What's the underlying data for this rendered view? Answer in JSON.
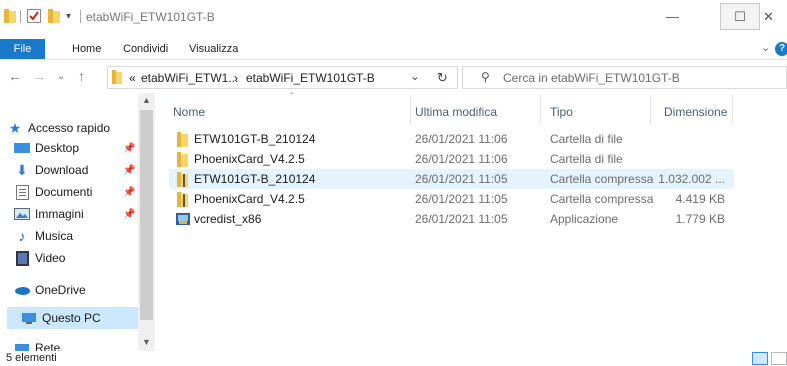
{
  "window": {
    "title": "etabWiFi_ETW101GT-B",
    "controls": {
      "minimize": "—",
      "maximize": "☐",
      "close": "✕"
    }
  },
  "ribbon": {
    "tabs": [
      "File",
      "Home",
      "Condividi",
      "Visualizza"
    ],
    "help_label": "?"
  },
  "address_bar": {
    "overflow_marker": "«",
    "crumb_1": "etabWiFi_ETW1...",
    "crumb_separator": "›",
    "crumb_2": "etabWiFi_ETW101GT-B",
    "dropdown_glyph": "⌄"
  },
  "search": {
    "placeholder": "Cerca in etabWiFi_ETW101GT-B"
  },
  "nav_pane": {
    "items": [
      {
        "label": "Accesso rapido",
        "icon": "star-icon"
      },
      {
        "label": "Desktop",
        "icon": "desktop-icon",
        "pinned": true
      },
      {
        "label": "Download",
        "icon": "download-icon",
        "pinned": true
      },
      {
        "label": "Documenti",
        "icon": "documents-icon",
        "pinned": true
      },
      {
        "label": "Immagini",
        "icon": "pictures-icon",
        "pinned": true
      },
      {
        "label": "Musica",
        "icon": "music-icon"
      },
      {
        "label": "Video",
        "icon": "video-icon"
      },
      {
        "label": "OneDrive",
        "icon": "cloud-icon"
      },
      {
        "label": "Questo PC",
        "icon": "computer-icon",
        "selected": true
      },
      {
        "label": "Rete",
        "icon": "network-icon"
      }
    ]
  },
  "file_list": {
    "columns": {
      "name": "Nome",
      "modified": "Ultima modifica",
      "type": "Tipo",
      "size": "Dimensione"
    },
    "rows": [
      {
        "name": "ETW101GT-B_210124",
        "modified": "26/01/2021 11:06",
        "type": "Cartella di file",
        "size": "",
        "icon": "folder-icon"
      },
      {
        "name": "PhoenixCard_V4.2.5",
        "modified": "26/01/2021 11:06",
        "type": "Cartella di file",
        "size": "",
        "icon": "folder-icon"
      },
      {
        "name": "ETW101GT-B_210124",
        "modified": "26/01/2021 11:05",
        "type": "Cartella compressa",
        "size": "1.032.002 ...",
        "icon": "zip-folder-icon",
        "selected": true
      },
      {
        "name": "PhoenixCard_V4.2.5",
        "modified": "26/01/2021 11:05",
        "type": "Cartella compressa",
        "size": "4.419 KB",
        "icon": "zip-folder-icon"
      },
      {
        "name": "vcredist_x86",
        "modified": "26/01/2021 11:05",
        "type": "Applicazione",
        "size": "1.779 KB",
        "icon": "installer-icon"
      }
    ]
  },
  "status_bar": {
    "count": "5 elementi"
  },
  "colors": {
    "accent": "#1979ca",
    "selection": "#cce8ff",
    "row_selection": "#e5f3ff",
    "folder": "#e8b43b"
  }
}
